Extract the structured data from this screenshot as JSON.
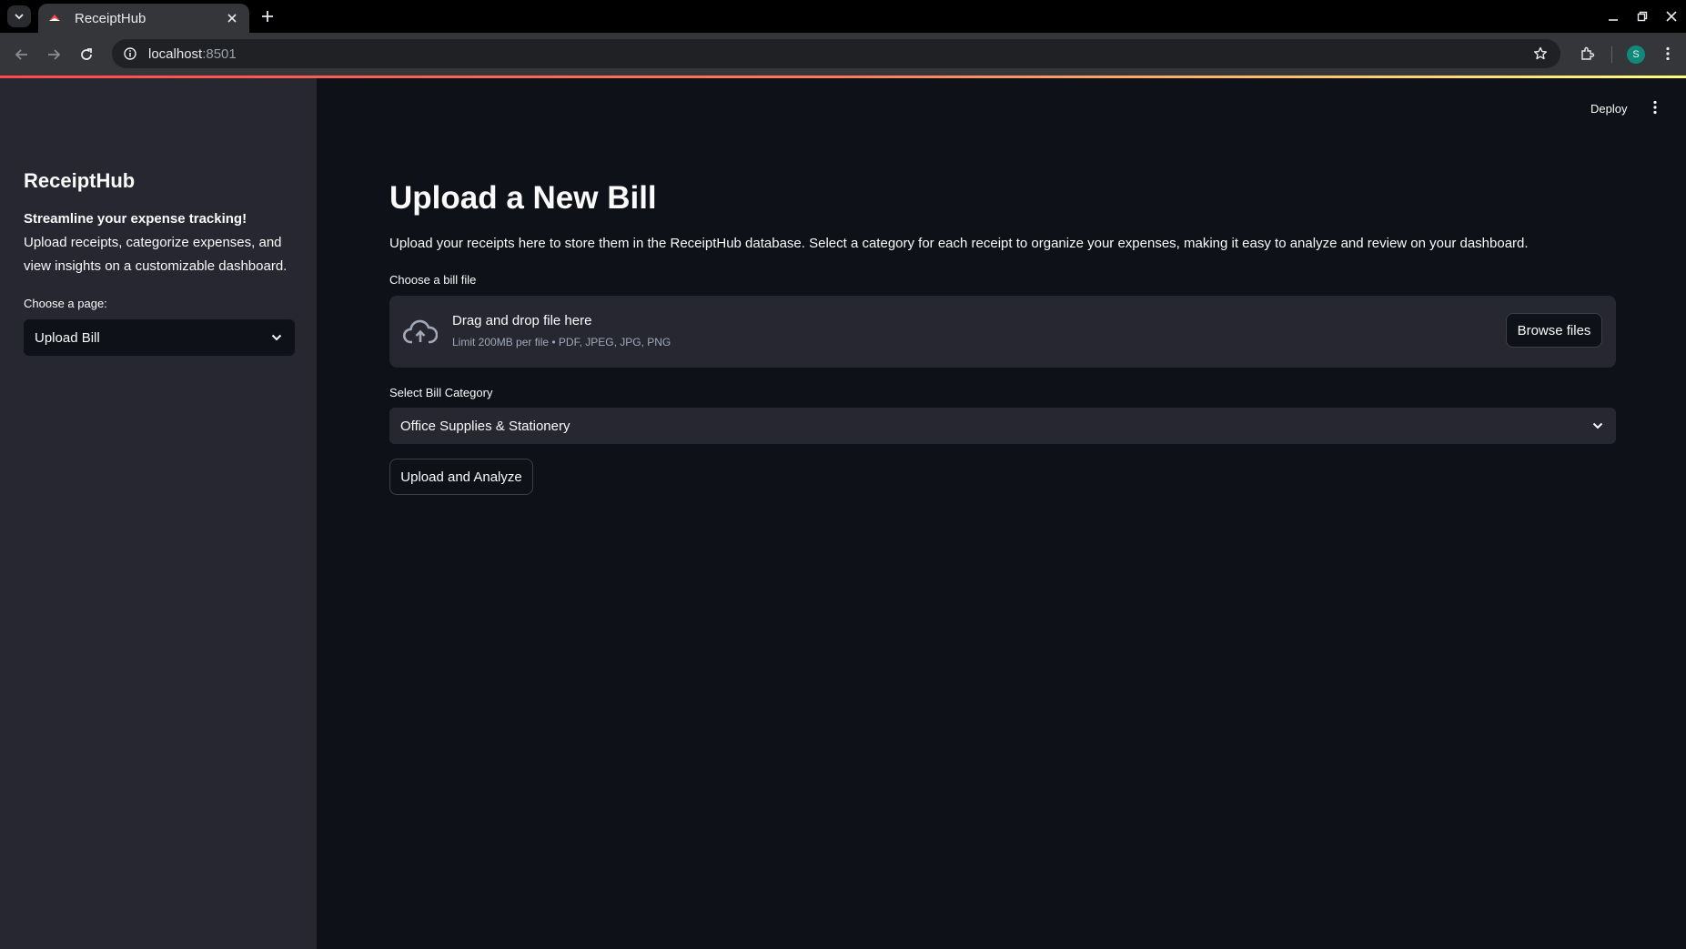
{
  "browser": {
    "tab_title": "ReceiptHub",
    "url_host": "localhost",
    "url_port": ":8501",
    "profile_initial": "S"
  },
  "colors": {
    "app_bg": "#0e1117",
    "sidebar_bg": "#262730",
    "accent": "#ff4b4b",
    "profile": "#11897a"
  },
  "sidebar": {
    "title": "ReceiptHub",
    "tagline": "Streamline your expense tracking!",
    "description": "Upload receipts, categorize expenses, and view insights on a customizable dashboard.",
    "page_select_label": "Choose a page:",
    "page_select_value": "Upload Bill"
  },
  "header": {
    "deploy_label": "Deploy"
  },
  "main": {
    "title": "Upload a New Bill",
    "description": "Upload your receipts here to store them in the ReceiptHub database. Select a category for each receipt to organize your expenses, making it easy to analyze and review on your dashboard.",
    "uploader": {
      "label": "Choose a bill file",
      "drop_text": "Drag and drop file here",
      "limit_text": "Limit 200MB per file • PDF, JPEG, JPG, PNG",
      "browse_label": "Browse files"
    },
    "category": {
      "label": "Select Bill Category",
      "value": "Office Supplies & Stationery"
    },
    "submit_label": "Upload and Analyze"
  },
  "icons": [
    "tab-list-icon",
    "streamlit-favicon-icon",
    "close-icon",
    "plus-icon",
    "minimize-icon",
    "restore-icon",
    "back-icon",
    "forward-icon",
    "reload-icon",
    "info-icon",
    "star-icon",
    "extensions-icon",
    "kebab-menu-icon",
    "chevron-down-icon",
    "cloud-upload-icon"
  ]
}
